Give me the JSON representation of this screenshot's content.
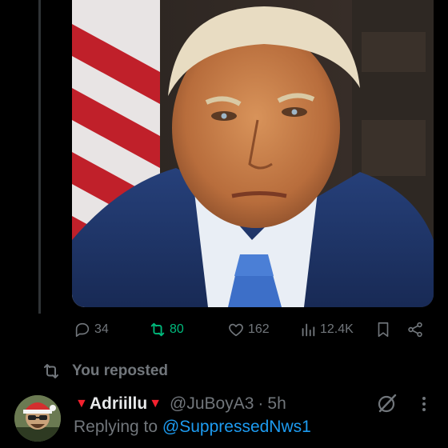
{
  "post_actions": {
    "replies": "34",
    "reposts": "80",
    "likes": "162",
    "views": "12.4K"
  },
  "colors": {
    "background": "#000000",
    "muted": "#71767b",
    "repost_active": "#00ba7c",
    "link": "#1d9bf0",
    "name_emoji": "#f4212e"
  },
  "repost_banner": {
    "text": "You reposted"
  },
  "next_tweet": {
    "display_name": "Adriillu",
    "handle": "@JuBoyA3",
    "time": "5h",
    "replying_prefix": "Replying to",
    "replying_to": "@SuppressedNws1"
  },
  "icons": {
    "reply": "reply-icon",
    "repost": "repost-icon",
    "like": "heart-icon",
    "views": "views-chart-icon",
    "bookmark": "bookmark-icon",
    "share": "share-icon",
    "grok": "grok-icon",
    "more": "more-vertical-icon"
  }
}
